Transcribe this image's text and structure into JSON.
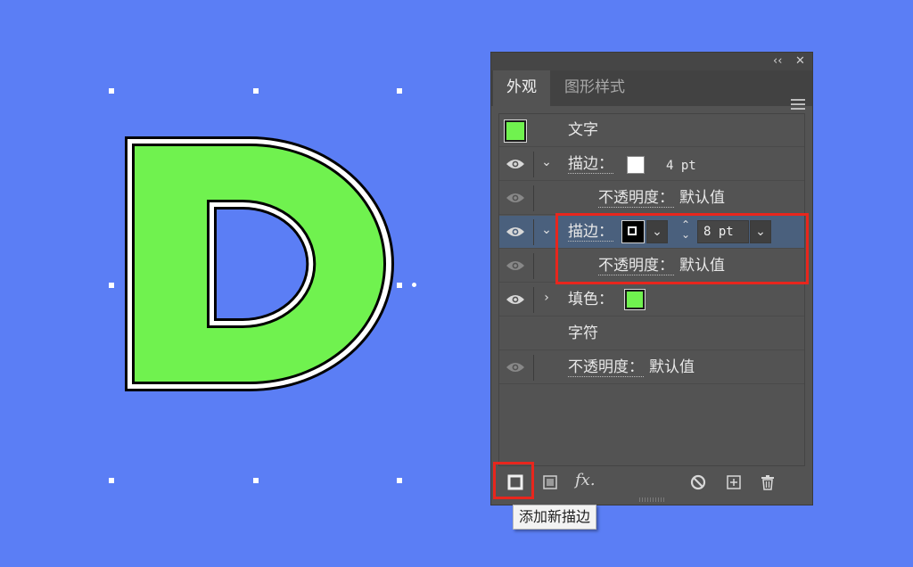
{
  "colors": {
    "background": "#5b7ef5",
    "fill_green": "#70f24f",
    "highlight_red": "#e8261d"
  },
  "canvas": {
    "letter": "D"
  },
  "panel": {
    "title_collapse": "‹‹",
    "title_close": "✕",
    "tabs": [
      {
        "label": "外观",
        "active": true
      },
      {
        "label": "图形样式",
        "active": false
      }
    ],
    "rows": {
      "header": {
        "label": "文字"
      },
      "stroke1": {
        "label": "描边：",
        "weight": "4 pt"
      },
      "stroke1_opacity": {
        "label": "不透明度：",
        "value": "默认值"
      },
      "stroke2": {
        "label": "描边：",
        "weight": "8 pt"
      },
      "stroke2_opacity": {
        "label": "不透明度：",
        "value": "默认值"
      },
      "fill": {
        "label": "填色："
      },
      "characters": {
        "label": "字符"
      },
      "opacity": {
        "label": "不透明度：",
        "value": "默认值"
      }
    },
    "bottom_icons": [
      "add-new-stroke-icon",
      "add-new-fill-icon",
      "fx-icon",
      "clear-icon",
      "duplicate-icon",
      "delete-icon"
    ],
    "fx_label": "fx."
  },
  "tooltip": {
    "text": "添加新描边"
  }
}
